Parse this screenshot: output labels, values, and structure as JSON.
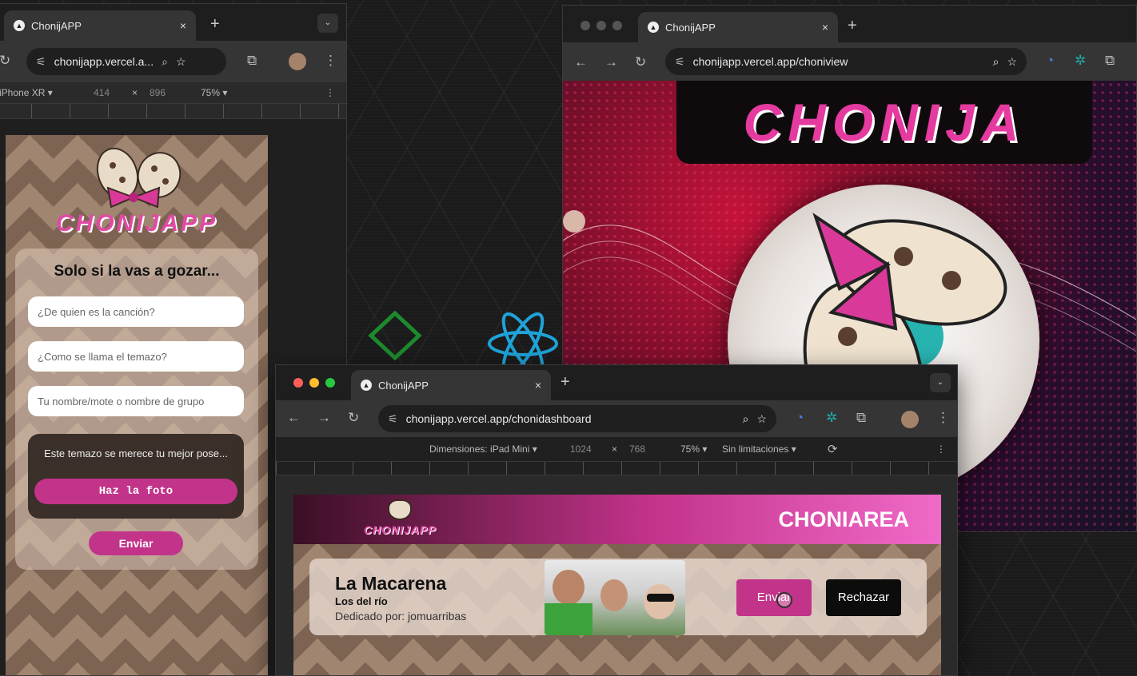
{
  "left_window": {
    "tab_title": "ChonijAPP",
    "tab_close": "×",
    "new_tab": "+",
    "url": "chonijapp.vercel.a...",
    "device": "iPhone XR ▾",
    "width": "414",
    "times": "×",
    "height": "896",
    "zoom": "75% ▾",
    "app": {
      "logo_text": "CHONIJAPP",
      "heading": "Solo si la vas a gozar...",
      "input1_placeholder": "¿De quien es la canción?",
      "input2_placeholder": "¿Como se llama el temazo?",
      "input3_placeholder": "Tu nombre/mote o nombre de grupo",
      "photo_prompt": "Este temazo se merece tu mejor pose...",
      "photo_button": "Haz la foto",
      "submit_button": "Enviar"
    }
  },
  "right_window": {
    "tab_title": "ChonijAPP",
    "tab_close": "×",
    "new_tab": "+",
    "url": "chonijapp.vercel.app/choniview",
    "banner_text": "CHONIJA"
  },
  "front_window": {
    "tab_title": "ChonijAPP",
    "tab_close": "×",
    "new_tab": "+",
    "url": "chonijapp.vercel.app/chonidashboard",
    "device": "Dimensiones: iPad Mini ▾",
    "width": "1024",
    "times": "×",
    "height": "768",
    "zoom": "75% ▾",
    "throttle": "Sin limitaciones ▾",
    "app": {
      "logo_text": "CHONIJAPP",
      "header_title": "CHONIAREA",
      "song_title": "La Macarena",
      "artist": "Los del río",
      "dedicated": "Dedicado por: jomuarribas",
      "send_button": "Enviar",
      "reject_button": "Rechazar"
    }
  },
  "colors": {
    "accent": "#c2338a",
    "dark": "#1f1f1f"
  }
}
